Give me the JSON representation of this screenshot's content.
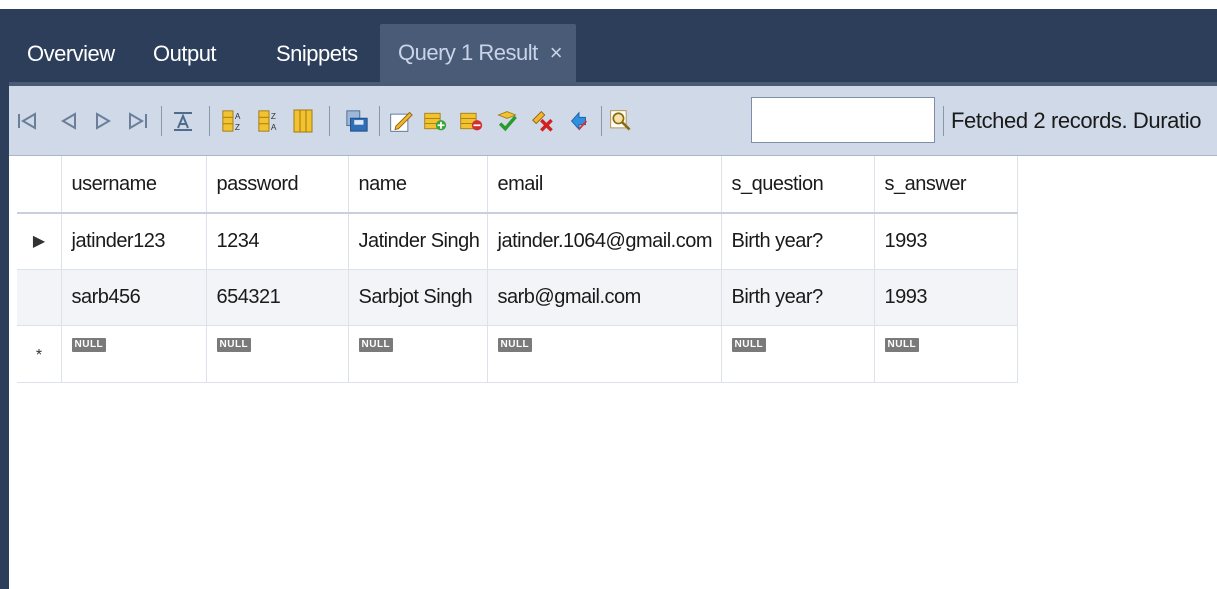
{
  "tabs": [
    {
      "label": "Overview"
    },
    {
      "label": "Output"
    },
    {
      "label": "Snippets"
    },
    {
      "label": "Query 1 Result",
      "close": "×"
    }
  ],
  "toolbar": {
    "filter_value": "",
    "status": "Fetched 2 records. Duratio",
    "icons": [
      "first-record-icon",
      "previous-record-icon",
      "next-record-icon",
      "last-record-icon",
      "text-format-icon",
      "sort-ascending-icon",
      "sort-descending-icon",
      "columns-icon",
      "save-icon",
      "edit-icon",
      "add-row-icon",
      "delete-row-icon",
      "apply-icon",
      "discard-icon",
      "refresh-icon",
      "search-icon"
    ]
  },
  "grid": {
    "columns": [
      "username",
      "password",
      "name",
      "email",
      "s_question",
      "s_answer"
    ],
    "rows": [
      {
        "indicator": "▶",
        "cells": [
          "jatinder123",
          "1234",
          "Jatinder Singh",
          "jatinder.1064@gmail.com",
          "Birth year?",
          "1993"
        ]
      },
      {
        "indicator": "",
        "cells": [
          "sarb456",
          "654321",
          "Sarbjot Singh",
          "sarb@gmail.com",
          "Birth year?",
          "1993"
        ]
      }
    ],
    "new_row": {
      "indicator": "*",
      "null_label": "NULL"
    }
  }
}
